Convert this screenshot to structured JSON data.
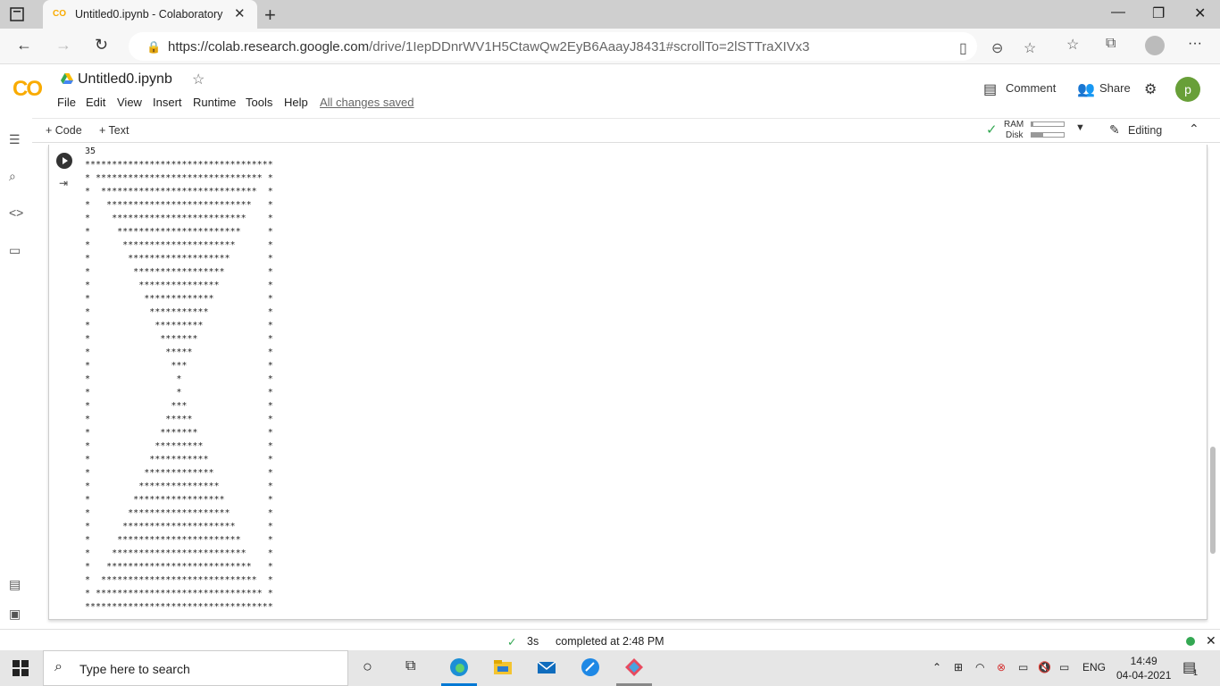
{
  "browser": {
    "tab_title": "Untitled0.ipynb - Colaboratory",
    "favicon_text": "CO",
    "url_host": "https://colab.research.google.com",
    "url_path": "/drive/1IepDDnrWV1H5CtawQw2EyB6AaayJ8431#scrollTo=2lSTTraXIVx3"
  },
  "colab": {
    "logo": "CO",
    "notebook_name": "Untitled0.ipynb",
    "menu": [
      "File",
      "Edit",
      "View",
      "Insert",
      "Runtime",
      "Tools",
      "Help"
    ],
    "save_status": "All changes saved",
    "comment_label": "Comment",
    "share_label": "Share",
    "user_initial": "p",
    "add_code_label": "+ Code",
    "add_text_label": "+ Text",
    "ram_label": "RAM",
    "disk_label": "Disk",
    "ram_usage": 0.05,
    "disk_usage": 0.35,
    "editing_label": "Editing"
  },
  "cell": {
    "output_lines": [
      "35",
      "***********************************",
      "* ******************************* *",
      "*  *****************************  *",
      "*   ***************************   *",
      "*    *************************    *",
      "*     ***********************     *",
      "*      *********************      *",
      "*       *******************       *",
      "*        *****************        *",
      "*         ***************         *",
      "*          *************          *",
      "*           ***********           *",
      "*            *********            *",
      "*             *******             *",
      "*              *****              *",
      "*               ***               *",
      "*                *                *",
      "*                *                *",
      "*               ***               *",
      "*              *****              *",
      "*             *******             *",
      "*            *********            *",
      "*           ***********           *",
      "*          *************          *",
      "*         ***************         *",
      "*        *****************        *",
      "*       *******************       *",
      "*      *********************      *",
      "*     ***********************     *",
      "*    *************************    *",
      "*   ***************************   *",
      "*  *****************************  *",
      "* ******************************* *",
      "***********************************"
    ]
  },
  "status": {
    "duration": "3s",
    "completed": "completed at 2:48 PM"
  },
  "taskbar": {
    "search_placeholder": "Type here to search",
    "language": "ENG",
    "time": "14:49",
    "date": "04-04-2021",
    "notification_count": "1"
  }
}
